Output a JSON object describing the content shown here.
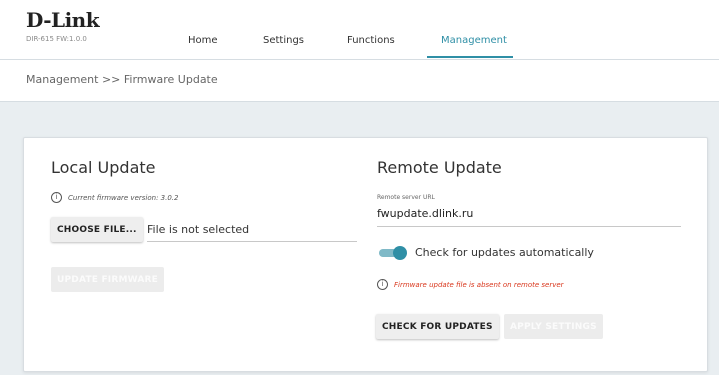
{
  "header": {
    "logo": "D-Link",
    "model": "DIR-615 FW:1.0.0",
    "nav": [
      {
        "label": "Home"
      },
      {
        "label": "Settings"
      },
      {
        "label": "Functions"
      },
      {
        "label": "Management"
      }
    ],
    "active_tab": "Management"
  },
  "breadcrumb": "Management >> Firmware Update",
  "local_update": {
    "title": "Local Update",
    "current_version": "Current firmware version: 3.0.2",
    "choose_file_label": "CHOOSE FILE...",
    "file_status": "File is not selected",
    "update_button": "UPDATE FIRMWARE"
  },
  "remote_update": {
    "title": "Remote Update",
    "server_label": "Remote server URL",
    "server_value": "fwupdate.dlink.ru",
    "auto_check_label": "Check for updates automatically",
    "auto_check_enabled": true,
    "error_message": "Firmware update file is absent on remote server",
    "check_button": "CHECK FOR UPDATES",
    "apply_button": "APPLY SETTINGS"
  },
  "colors": {
    "accent": "#2f8fa6",
    "error": "#d9381e"
  }
}
